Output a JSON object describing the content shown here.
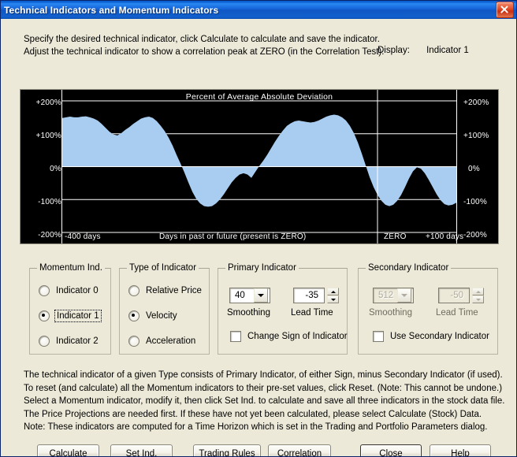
{
  "window": {
    "title": "Technical Indicators and Momentum Indicators",
    "close_icon": "close-x-icon"
  },
  "intro": {
    "line1": "Specify the desired technical indicator, click Calculate to calculate and save the indicator.",
    "line2": "Adjust the technical indicator to show a correlation peak at ZERO (in the Correlation Test)."
  },
  "display": {
    "label": "Display:",
    "value": "Indicator 1"
  },
  "chart_data": {
    "type": "area",
    "title": "Percent of Average Absolute Deviation",
    "xlabel": "Days in past or future (present is ZERO)",
    "ylabel": "",
    "ylim": [
      -200,
      200
    ],
    "yticks": [
      200,
      100,
      0,
      -100,
      -200
    ],
    "ytick_labels_left": [
      "+200%",
      "+100%",
      "0%",
      "-100%",
      "-200%"
    ],
    "ytick_labels_right": [
      "+200%",
      "+100%",
      "0%",
      "-100%",
      "-200%"
    ],
    "xlim": [
      -400,
      100
    ],
    "xtick_labels": [
      "-400 days",
      "ZERO",
      "+100 days"
    ],
    "grid": true,
    "zero_line_x": -0.0,
    "area_color": "#a8cdf0",
    "background": "#000000",
    "gridline_color": "#ffffff",
    "series": [
      {
        "name": "Percent of Average Absolute Deviation",
        "x": [
          -400,
          -395,
          -390,
          -385,
          -380,
          -375,
          -370,
          -365,
          -360,
          -355,
          -350,
          -345,
          -340,
          -335,
          -330,
          -325,
          -320,
          -315,
          -310,
          -305,
          -300,
          -295,
          -290,
          -285,
          -280,
          -275,
          -270,
          -265,
          -260,
          -255,
          -250,
          -245,
          -240,
          -235,
          -230,
          -225,
          -220,
          -215,
          -210,
          -205,
          -200,
          -195,
          -190,
          -185,
          -180,
          -175,
          -170,
          -165,
          -160,
          -155,
          -150,
          -145,
          -140,
          -135,
          -130,
          -125,
          -120,
          -115,
          -110,
          -105,
          -100,
          -95,
          -90,
          -85,
          -80,
          -75,
          -70,
          -65,
          -60,
          -55,
          -50,
          -45,
          -40,
          -35,
          -30,
          -25,
          -20,
          -15,
          -10,
          -5,
          0,
          5,
          10,
          15,
          20,
          25,
          30,
          35,
          40,
          45,
          50,
          55,
          60,
          65,
          70,
          75,
          80,
          85,
          90,
          95,
          100
        ],
        "values": [
          148,
          150,
          152,
          150,
          150,
          152,
          153,
          150,
          146,
          140,
          130,
          118,
          106,
          98,
          95,
          102,
          112,
          120,
          130,
          138,
          146,
          150,
          152,
          148,
          138,
          124,
          108,
          88,
          64,
          36,
          10,
          -18,
          -48,
          -76,
          -98,
          -112,
          -120,
          -122,
          -120,
          -112,
          -100,
          -84,
          -66,
          -48,
          -34,
          -24,
          -20,
          -24,
          -34,
          -16,
          2,
          18,
          36,
          56,
          76,
          94,
          110,
          124,
          132,
          138,
          140,
          138,
          136,
          134,
          136,
          140,
          146,
          152,
          156,
          158,
          156,
          150,
          140,
          124,
          102,
          74,
          40,
          4,
          -32,
          -62,
          -86,
          -104,
          -116,
          -120,
          -116,
          -104,
          -86,
          -62,
          -36,
          -14,
          -2,
          -6,
          -20,
          -40,
          -62,
          -84,
          -102,
          -114,
          -118,
          -116,
          -110,
          -104
        ]
      }
    ]
  },
  "momentum_group": {
    "legend": "Momentum Ind.",
    "options": [
      {
        "label": "Indicator 0",
        "selected": false,
        "focused": false
      },
      {
        "label": "Indicator 1",
        "selected": true,
        "focused": true
      },
      {
        "label": "Indicator 2",
        "selected": false,
        "focused": false
      }
    ]
  },
  "type_group": {
    "legend": "Type of Indicator",
    "options": [
      {
        "label": "Relative Price",
        "selected": false
      },
      {
        "label": "Velocity",
        "selected": true
      },
      {
        "label": "Acceleration",
        "selected": false
      }
    ]
  },
  "primary_group": {
    "legend": "Primary Indicator",
    "smoothing_value": "40",
    "smoothing_label": "Smoothing",
    "lead_time_value": "-35",
    "lead_time_label": "Lead Time",
    "checkbox_label": "Change Sign of Indicator",
    "checkbox_checked": false,
    "disabled": false
  },
  "secondary_group": {
    "legend": "Secondary Indicator",
    "smoothing_value": "512",
    "smoothing_label": "Smoothing",
    "lead_time_value": "-50",
    "lead_time_label": "Lead Time",
    "checkbox_label": "Use Secondary Indicator",
    "checkbox_checked": false,
    "disabled": true
  },
  "footer": {
    "line1": "The technical indicator of a given Type consists of Primary Indicator, of either Sign, minus Secondary Indicator (if used).",
    "line2": "To reset (and calculate) all the Momentum indicators to their pre-set values, click Reset.  (Note: This cannot be undone.)",
    "line3": "Select a Momentum indicator, modify it, then click Set Ind. to calculate and save all three indicators in the stock data file.",
    "line4": "The Price Projections are needed first. If these have not yet been calculated, please select Calculate (Stock) Data.",
    "line5": "Note: These indicators are computed for a Time Horizon which is set in the Trading and Portfolio Parameters dialog."
  },
  "buttons": {
    "calculate": "Calculate",
    "set_ind": "Set Ind.",
    "trading_rules": "Trading Rules",
    "correlation": "Correlation",
    "close": "Close",
    "help": "Help"
  }
}
